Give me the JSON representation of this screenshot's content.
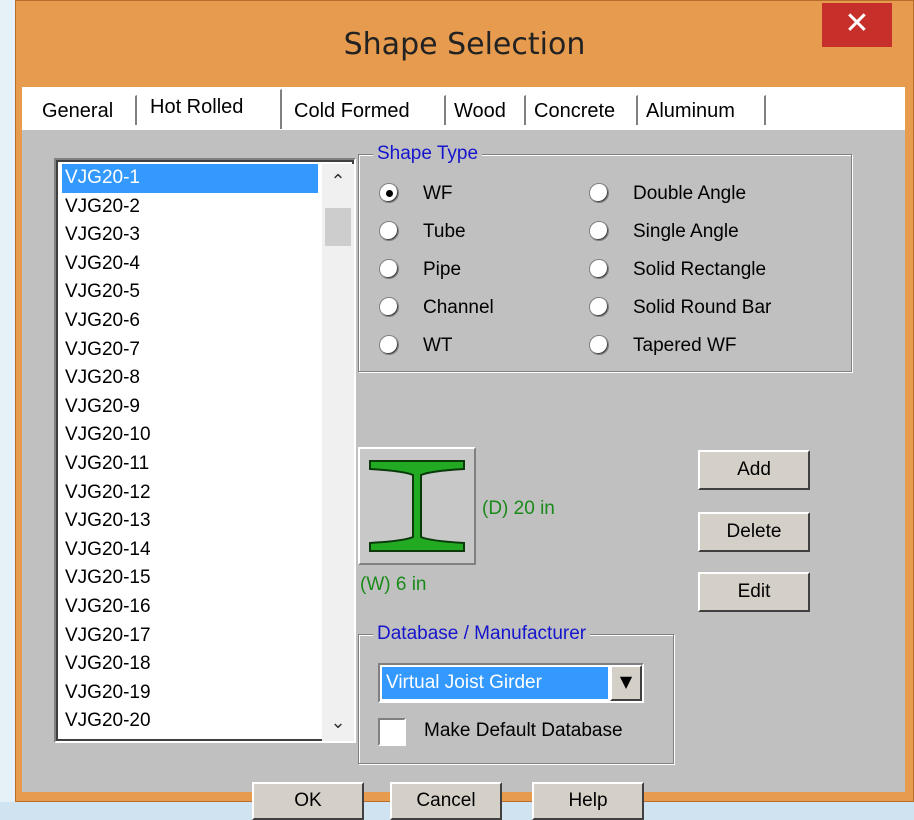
{
  "window": {
    "title": "Shape Selection",
    "close_label": "✕"
  },
  "tabs": [
    {
      "label": "General",
      "active": false
    },
    {
      "label": "Hot Rolled",
      "active": true
    },
    {
      "label": "Cold Formed",
      "active": false
    },
    {
      "label": "Wood",
      "active": false
    },
    {
      "label": "Concrete",
      "active": false
    },
    {
      "label": "Aluminum",
      "active": false
    }
  ],
  "shape_list": {
    "selected": "VJG20-1",
    "items": [
      "VJG20-1",
      "VJG20-2",
      "VJG20-3",
      "VJG20-4",
      "VJG20-5",
      "VJG20-6",
      "VJG20-7",
      "VJG20-8",
      "VJG20-9",
      "VJG20-10",
      "VJG20-11",
      "VJG20-12",
      "VJG20-13",
      "VJG20-14",
      "VJG20-15",
      "VJG20-16",
      "VJG20-17",
      "VJG20-18",
      "VJG20-19",
      "VJG20-20"
    ],
    "scroll_up": "⌃",
    "scroll_down": "⌄"
  },
  "shape_type": {
    "legend": "Shape Type",
    "selected": "WF",
    "options_left": [
      "WF",
      "Tube",
      "Pipe",
      "Channel",
      "WT"
    ],
    "options_right": [
      "Double Angle",
      "Single Angle",
      "Solid Rectangle",
      "Solid Round Bar",
      "Tapered WF"
    ]
  },
  "preview": {
    "icon": "wide-flange-icon",
    "depth_label": "(D) 20 in",
    "width_label": "(W) 6 in",
    "color": "#22aa22"
  },
  "side_buttons": {
    "add": "Add",
    "delete": "Delete",
    "edit": "Edit"
  },
  "database": {
    "legend": "Database / Manufacturer",
    "selected": "Virtual Joist Girder",
    "make_default_label": "Make Default Database",
    "make_default_checked": false
  },
  "footer": {
    "ok": "OK",
    "cancel": "Cancel",
    "help": "Help"
  }
}
